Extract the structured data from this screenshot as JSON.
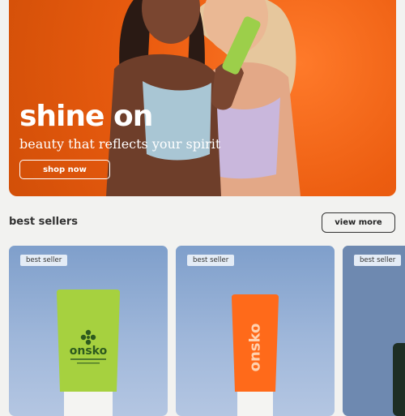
{
  "hero": {
    "title": "shine on",
    "subtitle": "beauty that reflects your spirit",
    "cta_label": "shop now"
  },
  "section": {
    "title": "best sellers",
    "view_more_label": "view more"
  },
  "products": [
    {
      "badge": "best seller",
      "brand": "onsko",
      "tube_color": "#a6d13f"
    },
    {
      "badge": "best seller",
      "brand": "onsko",
      "tube_color": "#ff6a1a"
    },
    {
      "badge": "best seller"
    }
  ]
}
